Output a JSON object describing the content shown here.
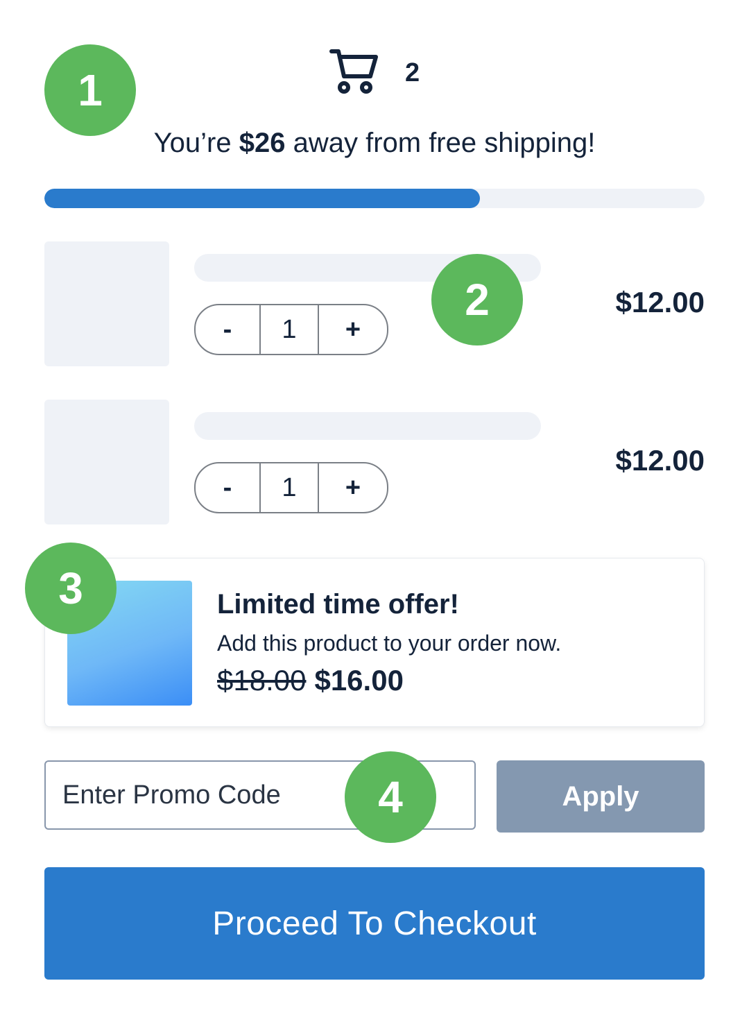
{
  "header": {
    "cart_icon": "shopping-cart-icon",
    "cart_count": "2"
  },
  "shipping": {
    "prefix": "You’re ",
    "amount": "$26",
    "suffix": " away from free shipping!",
    "progress_fraction": 0.66
  },
  "cart": {
    "items": [
      {
        "decrement_label": "-",
        "quantity": "1",
        "increment_label": "+",
        "price": "$12.00"
      },
      {
        "decrement_label": "-",
        "quantity": "1",
        "increment_label": "+",
        "price": "$12.00"
      }
    ]
  },
  "offer": {
    "title": "Limited time offer!",
    "subtitle": "Add this product to your order now.",
    "old_price": "$18.00",
    "new_price": "$16.00"
  },
  "promo": {
    "placeholder": "Enter Promo Code",
    "apply_label": "Apply"
  },
  "checkout": {
    "label": "Proceed To Checkout"
  },
  "markers": [
    "1",
    "2",
    "3",
    "4"
  ],
  "colors": {
    "primary": "#2a7bcc",
    "marker": "#5cb85c",
    "apply_disabled": "#8498b0",
    "placeholder_fill": "#eff2f7",
    "text": "#14233a"
  }
}
